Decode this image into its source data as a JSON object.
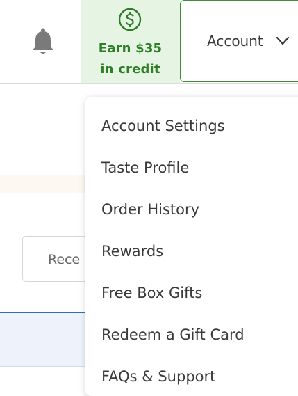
{
  "header": {
    "notifications": {
      "icon": "bell-icon"
    },
    "credit": {
      "icon": "dollar-circle-icon",
      "line1": "Earn $35",
      "line2": "in credit",
      "color": "#2e7d27",
      "background": "#e6f4e4"
    },
    "account": {
      "label": "Account",
      "icon": "chevron-down-icon",
      "border_color": "#3c8d33"
    }
  },
  "background": {
    "recent_field_text": "Rece"
  },
  "account_menu": {
    "items": [
      {
        "label": "Account Settings"
      },
      {
        "label": "Taste Profile"
      },
      {
        "label": "Order History"
      },
      {
        "label": "Rewards"
      },
      {
        "label": "Free Box Gifts"
      },
      {
        "label": "Redeem a Gift Card"
      },
      {
        "label": "FAQs & Support"
      }
    ]
  }
}
